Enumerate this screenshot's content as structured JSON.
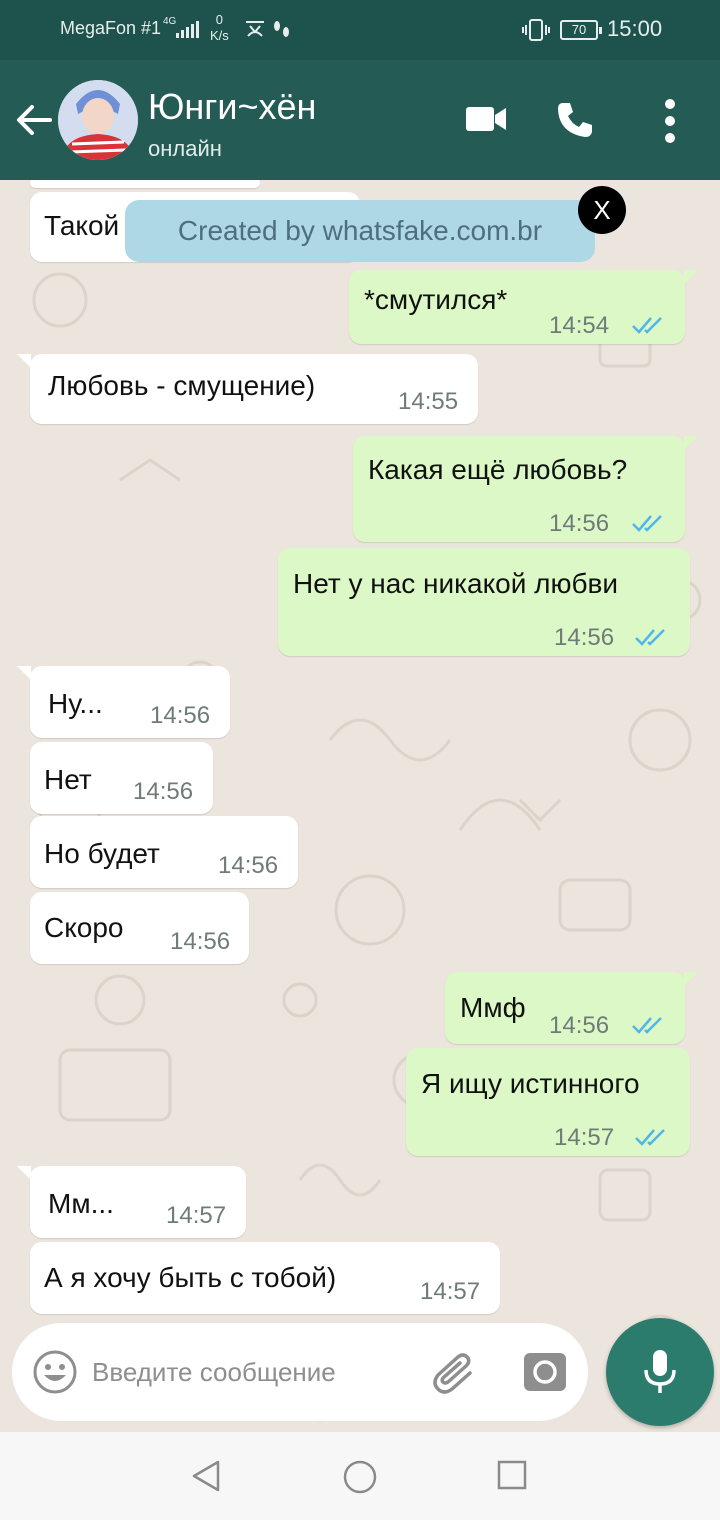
{
  "status_bar": {
    "carrier": "MegaFon #1",
    "network": "4G",
    "speed_value": "0",
    "speed_unit": "K/s",
    "battery": "70",
    "time": "15:00"
  },
  "header": {
    "contact_name": "Юнги~хён",
    "status": "онлайн"
  },
  "toast": {
    "text": "Created by whatsfake.com.br",
    "close_label": "X"
  },
  "messages": [
    {
      "dir": "in",
      "text": "Такой",
      "time": ""
    },
    {
      "dir": "out",
      "text": "*смутился*",
      "time": "14:54"
    },
    {
      "dir": "in",
      "text": "Любовь - смущение)",
      "time": "14:55"
    },
    {
      "dir": "out",
      "text": "Какая ещё любовь?",
      "time": "14:56"
    },
    {
      "dir": "out",
      "text": "Нет у нас никакой любви",
      "time": "14:56"
    },
    {
      "dir": "in",
      "text": "Ну...",
      "time": "14:56"
    },
    {
      "dir": "in",
      "text": "Нет",
      "time": "14:56"
    },
    {
      "dir": "in",
      "text": "Но будет",
      "time": "14:56"
    },
    {
      "dir": "in",
      "text": "Скоро",
      "time": "14:56"
    },
    {
      "dir": "out",
      "text": "Ммф",
      "time": "14:56"
    },
    {
      "dir": "out",
      "text": "Я ищу истинного",
      "time": "14:57"
    },
    {
      "dir": "in",
      "text": "Мм...",
      "time": "14:57"
    },
    {
      "dir": "in",
      "text": "А я хочу быть с тобой)",
      "time": "14:57"
    }
  ],
  "input": {
    "placeholder": "Введите сообщение"
  },
  "colors": {
    "header": "#245c55",
    "status_bar": "#1e524c",
    "outgoing_bubble": "#dcf8c6",
    "incoming_bubble": "#ffffff",
    "read_ticks": "#4fb6ec",
    "mic_button": "#2c7c6d"
  },
  "icons": [
    "back-arrow-icon",
    "video-call-icon",
    "phone-icon",
    "more-options-icon",
    "emoji-icon",
    "attach-icon",
    "camera-icon",
    "mic-icon",
    "nav-back-icon",
    "nav-home-icon",
    "nav-recents-icon"
  ]
}
